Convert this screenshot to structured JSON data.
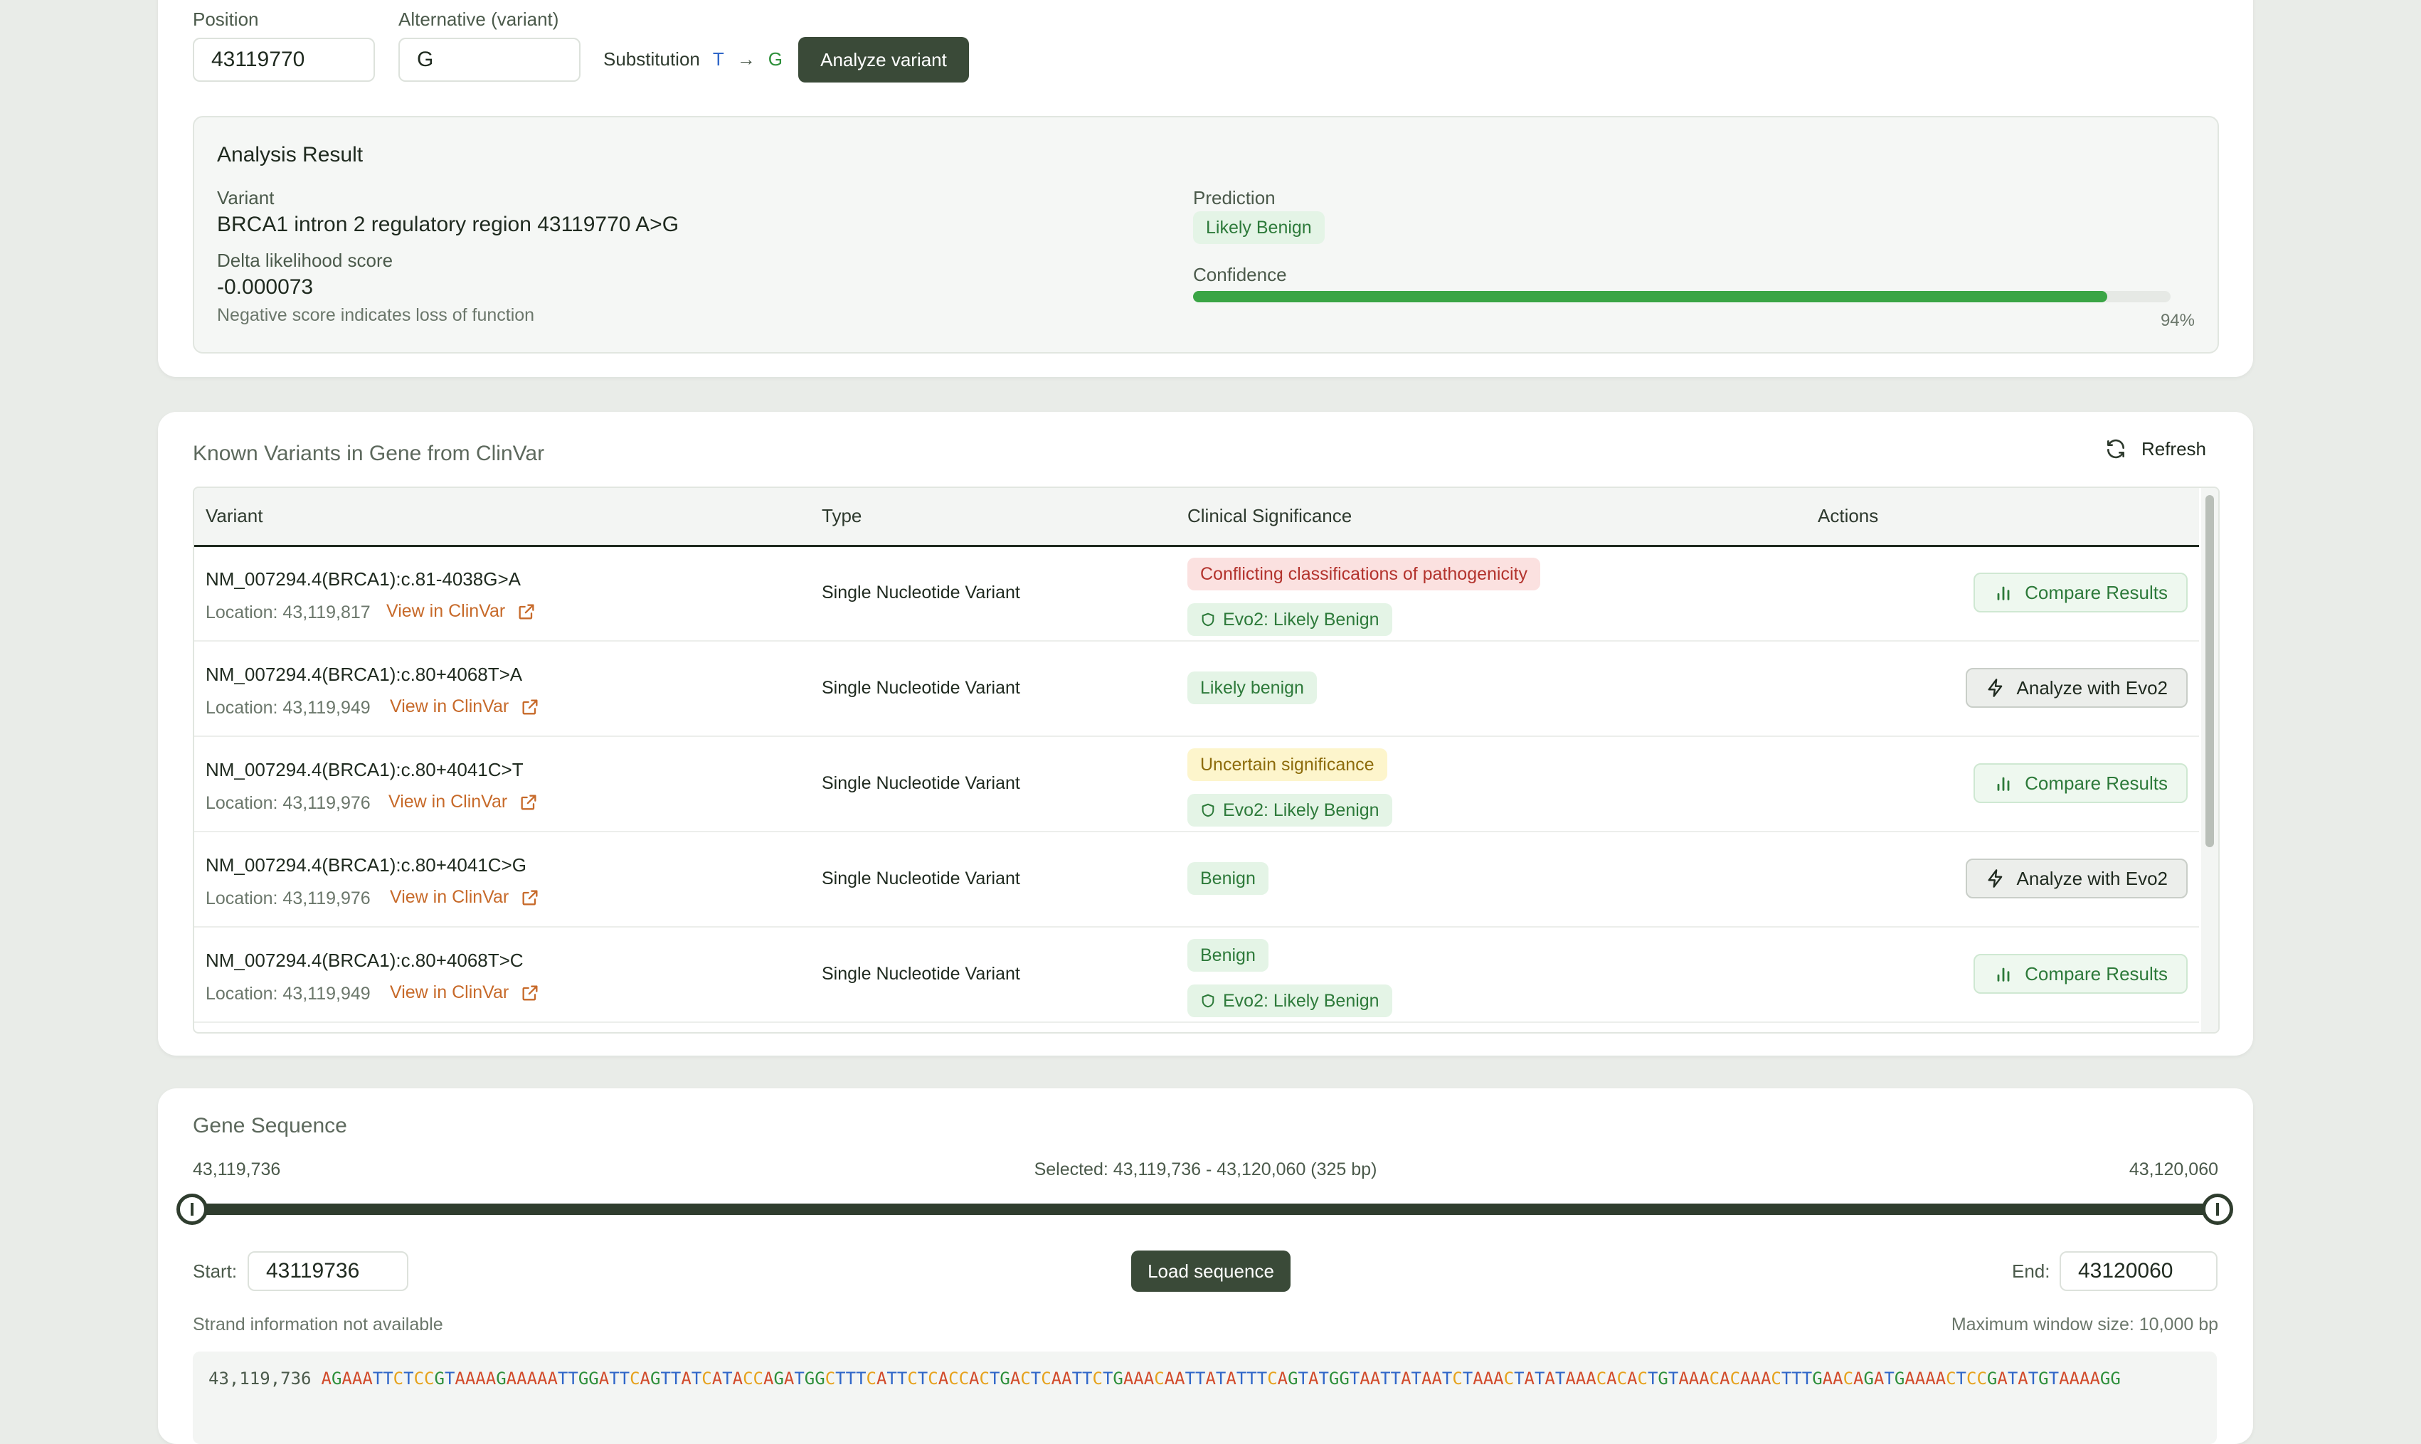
{
  "input": {
    "position_label": "Position",
    "position_value": "43119770",
    "alt_label": "Alternative (variant)",
    "alt_value": "G",
    "substitution_label": "Substitution",
    "sub_ref": "T",
    "sub_arrow": "→",
    "sub_alt": "G",
    "analyze_button": "Analyze variant"
  },
  "result": {
    "title": "Analysis Result",
    "variant_label": "Variant",
    "variant_value": "BRCA1 intron 2 regulatory region 43119770 A>G",
    "delta_label": "Delta likelihood score",
    "delta_value": "-0.000073",
    "delta_note": "Negative score indicates loss of function",
    "prediction_label": "Prediction",
    "prediction_value": "Likely Benign",
    "confidence_label": "Confidence",
    "confidence_percent": "94%",
    "confidence_fraction": 0.935
  },
  "clinvar": {
    "title": "Known Variants in Gene from ClinVar",
    "refresh_label": "Refresh",
    "columns": [
      "Variant",
      "Type",
      "Clinical Significance",
      "Actions"
    ],
    "rows": [
      {
        "name": "NM_007294.4(BRCA1):c.81-4038G>A",
        "location": "Location: 43,119,817",
        "link": "View in ClinVar",
        "type": "Single Nucleotide Variant",
        "significance": "Conflicting classifications of pathogenicity",
        "sig_color": "red",
        "evo": "Evo2: Likely Benign",
        "action": "Compare Results"
      },
      {
        "name": "NM_007294.4(BRCA1):c.80+4068T>A",
        "location": "Location: 43,119,949",
        "link": "View in ClinVar",
        "type": "Single Nucleotide Variant",
        "significance": "Likely benign",
        "sig_color": "green",
        "evo": "",
        "action": "Analyze with Evo2"
      },
      {
        "name": "NM_007294.4(BRCA1):c.80+4041C>T",
        "location": "Location: 43,119,976",
        "link": "View in ClinVar",
        "type": "Single Nucleotide Variant",
        "significance": "Uncertain significance",
        "sig_color": "yellow",
        "evo": "Evo2: Likely Benign",
        "action": "Compare Results"
      },
      {
        "name": "NM_007294.4(BRCA1):c.80+4041C>G",
        "location": "Location: 43,119,976",
        "link": "View in ClinVar",
        "type": "Single Nucleotide Variant",
        "significance": "Benign",
        "sig_color": "green",
        "evo": "",
        "action": "Analyze with Evo2"
      },
      {
        "name": "NM_007294.4(BRCA1):c.80+4068T>C",
        "location": "Location: 43,119,949",
        "link": "View in ClinVar",
        "type": "Single Nucleotide Variant",
        "significance": "Benign",
        "sig_color": "green",
        "evo": "Evo2: Likely Benign",
        "action": "Compare Results"
      }
    ]
  },
  "sequence": {
    "title": "Gene Sequence",
    "range_start": "43,119,736",
    "range_end": "43,120,060",
    "selected": "Selected: 43,119,736 - 43,120,060 (325 bp)",
    "start_label": "Start:",
    "start_value": "43119736",
    "load_button": "Load sequence",
    "end_label": "End:",
    "end_value": "43120060",
    "strand_note": "Strand information not available",
    "max_window": "Maximum window size: 10,000 bp",
    "seq_pos": "43,119,736",
    "bases": "AGAAATTCTCCGTAAAAGAAAAATTGGATTCAGTTATCATACCAGATGGCTTTCATTCTCACCACTGACTCAATTCTGAAACAATTATATTTCAGTATGGTAATTATAATCTAAACTATATAAACACACTGTAAACACAAACTTTGAACAGATGAAAACTCCGATATGTAAAAGG"
  }
}
